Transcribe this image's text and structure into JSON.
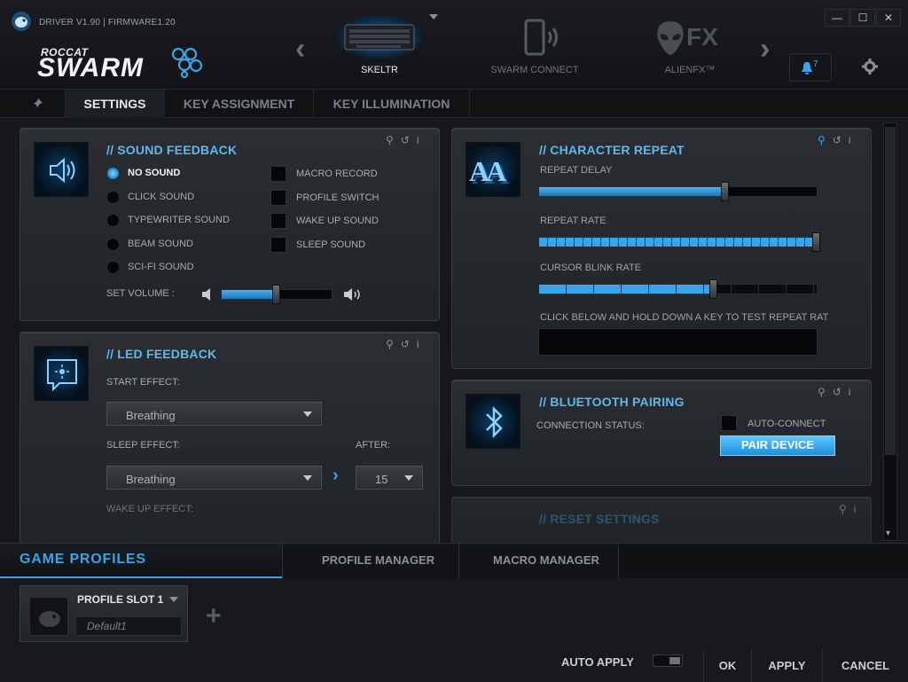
{
  "window": {
    "title": "DRIVER V1.90 | FIRMWARE1.20",
    "brand_top": "ROCCAT",
    "brand_main": "SWARM",
    "minimize_label": "—",
    "maximize_label": "☐",
    "close_label": "✕"
  },
  "devices": [
    {
      "label": "SKELTR",
      "active": true
    },
    {
      "label": "SWARM CONNECT",
      "active": false
    },
    {
      "label": "ALIENFX™",
      "active": false
    }
  ],
  "alienfx_text": "FX",
  "notifications": {
    "count": "7"
  },
  "tabs": [
    {
      "label": "SETTINGS",
      "selected": true
    },
    {
      "label": "KEY ASSIGNMENT",
      "selected": false
    },
    {
      "label": "KEY ILLUMINATION",
      "selected": false
    }
  ],
  "sound_feedback": {
    "title": "// SOUND FEEDBACK",
    "radios": [
      {
        "label": "NO SOUND",
        "selected": true
      },
      {
        "label": "CLICK SOUND",
        "selected": false
      },
      {
        "label": "TYPEWRITER SOUND",
        "selected": false
      },
      {
        "label": "BEAM SOUND",
        "selected": false
      },
      {
        "label": "SCI-FI SOUND",
        "selected": false
      }
    ],
    "checkboxes": [
      {
        "label": "MACRO RECORD",
        "checked": false
      },
      {
        "label": "PROFILE SWITCH",
        "checked": false
      },
      {
        "label": "WAKE UP SOUND",
        "checked": false
      },
      {
        "label": "SLEEP SOUND",
        "checked": false
      }
    ],
    "volume_label": "SET VOLUME :",
    "volume_level": 0.5
  },
  "led_feedback": {
    "title": "// LED FEEDBACK",
    "start_label": "START EFFECT:",
    "start_value": "Breathing",
    "sleep_label": "SLEEP EFFECT:",
    "sleep_value": "Breathing",
    "after_label": "AFTER:",
    "after_value": "15",
    "wake_label": "WAKE UP EFFECT:"
  },
  "character_repeat": {
    "title": "// CHARACTER REPEAT",
    "icon_text": "AA",
    "delay_label": "REPEAT DELAY",
    "delay_level": 0.67,
    "rate_label": "REPEAT RATE",
    "rate_level": 1.0,
    "blink_label": "CURSOR BLINK RATE",
    "blink_level": 0.63,
    "test_label": "CLICK BELOW AND HOLD DOWN A KEY TO TEST REPEAT RAT"
  },
  "bluetooth": {
    "title": "// BLUETOOTH PAIRING",
    "status_label": "CONNECTION STATUS:",
    "auto_connect_label": "AUTO-CONNECT",
    "pair_button": "PAIR DEVICE"
  },
  "reset": {
    "title": "// RESET SETTINGS"
  },
  "game_profiles": {
    "title": "GAME PROFILES",
    "tabs": [
      "PROFILE MANAGER",
      "MACRO MANAGER"
    ],
    "slot_label": "PROFILE SLOT 1",
    "slot_name": "Default1"
  },
  "footer": {
    "auto_apply_label": "AUTO APPLY",
    "ok": "OK",
    "apply": "APPLY",
    "cancel": "CANCEL"
  },
  "colors": {
    "accent": "#4db0ee",
    "title_blue": "#5fb8ee"
  }
}
